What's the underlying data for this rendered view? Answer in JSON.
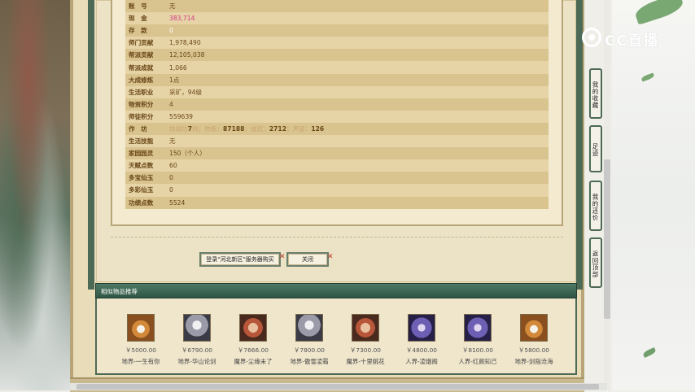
{
  "info_rows": [
    {
      "label": "账　号",
      "value": "无"
    },
    {
      "label": "现　金",
      "value": "383,714"
    },
    {
      "label": "存　款",
      "value": "0"
    },
    {
      "label": "师门贡献",
      "value": "1,978,490"
    },
    {
      "label": "帮派贡献",
      "value": "12,105,038"
    },
    {
      "label": "帮派成就",
      "value": "1,066"
    },
    {
      "label": "大成修炼",
      "value": "1点"
    },
    {
      "label": "生活职业",
      "value": "采矿，94级"
    },
    {
      "label": "物资积分",
      "value": "4"
    },
    {
      "label": "师徒积分",
      "value": "559639"
    },
    {
      "label": "作　坊",
      "value_parts": {
        "grade_label": "坊规坊",
        "grade_value": "7",
        "level_label": "段；熟练：",
        "proficiency": "87188",
        "achievement_label": "；成就：",
        "achievement": "2712",
        "fame_label": "；声望：",
        "fame": "126"
      }
    },
    {
      "label": "生活技能",
      "value": "无"
    },
    {
      "label": "家园园灵",
      "value": "150（个人）"
    },
    {
      "label": "天赋点数",
      "value": "60"
    },
    {
      "label": "多宝仙玉",
      "value": "0"
    },
    {
      "label": "多彩仙玉",
      "value": "0"
    },
    {
      "label": "功绩点数",
      "value": "5524"
    }
  ],
  "buttons": {
    "login_label": "登录\"河北新区\"服务器购买",
    "close_label": "关闭",
    "x_mark": "✕"
  },
  "recommend": {
    "title": "相似物品推荐",
    "items": [
      {
        "avatar": "tiger",
        "price": "￥5000.00",
        "name": "地界-一生有你"
      },
      {
        "avatar": "ghost",
        "price": "￥6790.00",
        "name": "地界-华山论剑"
      },
      {
        "avatar": "demon",
        "price": "￥7666.00",
        "name": "魔界-尘缘未了"
      },
      {
        "avatar": "ghost",
        "price": "￥7800.00",
        "name": "地界-傲雪凌霜"
      },
      {
        "avatar": "demon",
        "price": "￥7300.00",
        "name": "魔界-十里桃花"
      },
      {
        "avatar": "violet",
        "price": "￥4800.00",
        "name": "人界-凌烟阁"
      },
      {
        "avatar": "violet",
        "price": "￥8100.00",
        "name": "人界-红颜知己"
      },
      {
        "avatar": "tiger",
        "price": "￥5800.00",
        "name": "地界-剑指沧海"
      }
    ]
  },
  "side_tabs": [
    "我的收藏",
    "足迹",
    "我的还价",
    "返回顶部"
  ],
  "logo_text": "CC直播",
  "colors": {
    "cash": "#d23a8a",
    "header_green": "#2f5444",
    "parchment": "#e9dcb9"
  }
}
